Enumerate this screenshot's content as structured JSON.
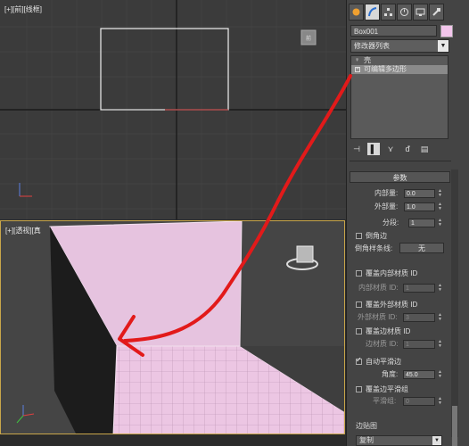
{
  "front_viewport": {
    "label": "[+][前][线框]"
  },
  "persp_viewport": {
    "label": "[+][透视][真"
  },
  "command_panel": {
    "tabs": [
      "create-icon",
      "modify-icon",
      "hierarchy-icon",
      "motion-icon",
      "display-icon",
      "utilities-icon"
    ],
    "object_name": "Box001",
    "object_color": "#f3c6ec",
    "modifier_list_label": "修改器列表",
    "stack": {
      "items": [
        {
          "label": "壳",
          "selected": false
        },
        {
          "label": "可编辑多边形",
          "selected": true
        }
      ]
    },
    "params": {
      "title": "参数",
      "inner_amount_label": "内部量:",
      "inner_amount_value": "0.0",
      "outer_amount_label": "外部量:",
      "outer_amount_value": "1.0",
      "segments_label": "分段:",
      "segments_value": "1",
      "bevel_edges_label": "倒角边",
      "bevel_spline_label": "倒角样条线:",
      "bevel_spline_value": "无",
      "override_inner_mat_label": "覆盖内部材质 ID",
      "inner_mat_id_label": "内部材质 ID:",
      "inner_mat_id_value": "1",
      "override_outer_mat_label": "覆盖外部材质 ID",
      "outer_mat_id_label": "外部材质 ID:",
      "outer_mat_id_value": "3",
      "override_edge_mat_label": "覆盖边材质 ID",
      "edge_mat_id_label": "边材质 ID:",
      "edge_mat_id_value": "1",
      "auto_smooth_label": "自动平滑边",
      "auto_smooth_checked": true,
      "angle_label": "角度:",
      "angle_value": "45.0",
      "override_edge_smooth_label": "覆盖边平滑组",
      "smooth_group_label": "平滑组:",
      "smooth_group_value": "0",
      "edge_map_label": "边贴图",
      "edge_map_value": "复制"
    }
  }
}
